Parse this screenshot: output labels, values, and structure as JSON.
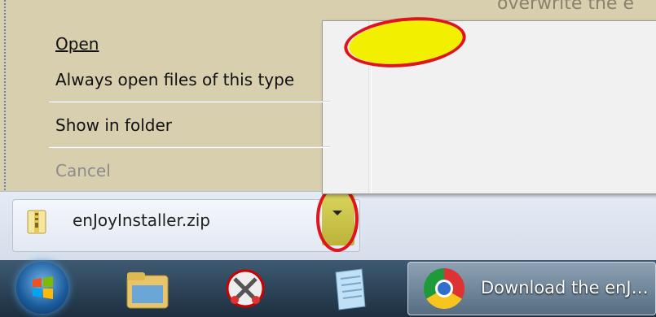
{
  "background_text": "overwrite the e",
  "context_menu": {
    "items": [
      {
        "label": "Open",
        "enabled": true
      },
      {
        "label": "Always open files of this type",
        "enabled": true
      },
      {
        "label": "Show in folder",
        "enabled": true
      },
      {
        "label": "Cancel",
        "enabled": false
      }
    ]
  },
  "download": {
    "filename": "enJoyInstaller.zip"
  },
  "taskbar": {
    "task_label": "Download the enJ…"
  },
  "colors": {
    "highlight_yellow": "#f2f000",
    "annotation_red": "#e0141c"
  }
}
